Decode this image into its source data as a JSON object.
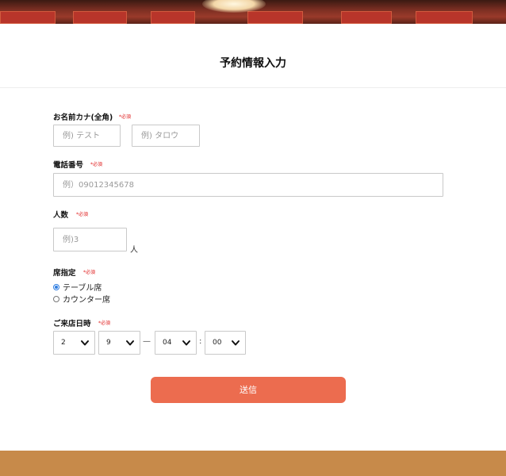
{
  "page": {
    "title": "予約情報入力"
  },
  "form": {
    "required_mark": "*必須",
    "name": {
      "label": "お名前カナ(全角)",
      "last_placeholder": "例) テスト",
      "first_placeholder": "例) タロウ"
    },
    "phone": {
      "label": "電話番号",
      "placeholder": "例）09012345678"
    },
    "people": {
      "label": "人数",
      "placeholder": "例)3",
      "unit": "人"
    },
    "seat": {
      "label": "席指定",
      "options": [
        {
          "label": "テーブル席",
          "checked": true
        },
        {
          "label": "カウンター席",
          "checked": false
        }
      ]
    },
    "visit": {
      "label": "ご来店日時",
      "month": "2",
      "day": "9",
      "range_separator": "—",
      "hour": "04",
      "time_separator": ":",
      "minute": "00"
    },
    "submit_label": "送信"
  },
  "colors": {
    "accent": "#ec6c4f",
    "required": "#e02020",
    "footer": "#c78a4a",
    "radio_selected": "#2f7de1"
  },
  "icons": {
    "select_arrow": "chevron-down-icon"
  }
}
